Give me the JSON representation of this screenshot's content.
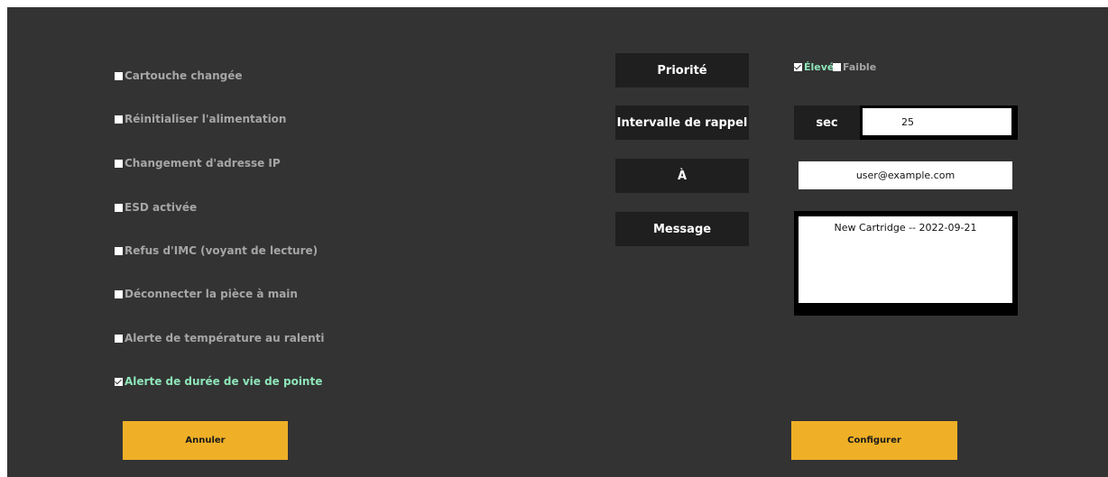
{
  "alerts": [
    {
      "label": "Cartouche changée",
      "checked": false
    },
    {
      "label": "Réinitialiser l'alimentation",
      "checked": false
    },
    {
      "label": "Changement d'adresse IP",
      "checked": false
    },
    {
      "label": "ESD activée",
      "checked": false
    },
    {
      "label": "Refus d'IMC (voyant de lecture)",
      "checked": false
    },
    {
      "label": "Déconnecter la pièce à main",
      "checked": false
    },
    {
      "label": "Alerte de température au ralenti",
      "checked": false
    },
    {
      "label": "Alerte de durée de vie de pointe",
      "checked": true
    }
  ],
  "priority": {
    "label": "Priorité",
    "high_label": "Élevé",
    "high_checked": true,
    "low_label": "Faible",
    "low_checked": false
  },
  "interval": {
    "label": "Intervalle de rappel",
    "unit": "sec",
    "value": "25"
  },
  "to": {
    "label": "À",
    "value": "user@example.com"
  },
  "message": {
    "label": "Message",
    "value": "New Cartridge -- 2022-09-21"
  },
  "buttons": {
    "cancel": "Annuler",
    "configure": "Configurer"
  },
  "colors": {
    "background": "#333333",
    "checked_text": "#8ee5b9",
    "unchecked_text": "#a6a6a6",
    "button": "#efb027",
    "label_bg": "#1f1f1f"
  }
}
